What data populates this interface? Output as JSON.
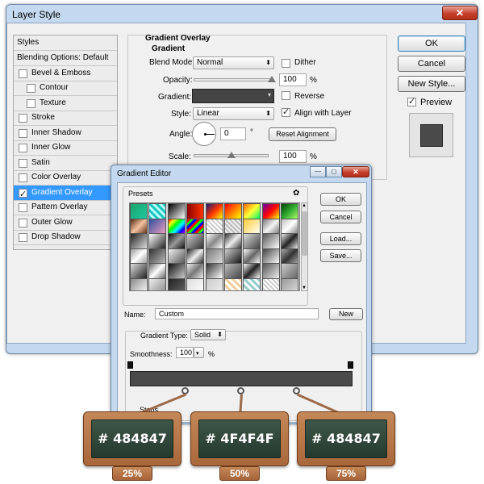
{
  "layer_style": {
    "title": "Layer Style",
    "close_glyph": "✕",
    "styles_header": "Styles",
    "items": [
      {
        "label": "Blending Options: Default",
        "checkbox": false,
        "checked": false,
        "selected": false,
        "indent": false
      },
      {
        "label": "Bevel & Emboss",
        "checkbox": true,
        "checked": false,
        "selected": false,
        "indent": false
      },
      {
        "label": "Contour",
        "checkbox": true,
        "checked": false,
        "selected": false,
        "indent": true
      },
      {
        "label": "Texture",
        "checkbox": true,
        "checked": false,
        "selected": false,
        "indent": true
      },
      {
        "label": "Stroke",
        "checkbox": true,
        "checked": false,
        "selected": false,
        "indent": false
      },
      {
        "label": "Inner Shadow",
        "checkbox": true,
        "checked": false,
        "selected": false,
        "indent": false
      },
      {
        "label": "Inner Glow",
        "checkbox": true,
        "checked": false,
        "selected": false,
        "indent": false
      },
      {
        "label": "Satin",
        "checkbox": true,
        "checked": false,
        "selected": false,
        "indent": false
      },
      {
        "label": "Color Overlay",
        "checkbox": true,
        "checked": false,
        "selected": false,
        "indent": false
      },
      {
        "label": "Gradient Overlay",
        "checkbox": true,
        "checked": true,
        "selected": true,
        "indent": false
      },
      {
        "label": "Pattern Overlay",
        "checkbox": true,
        "checked": false,
        "selected": false,
        "indent": false
      },
      {
        "label": "Outer Glow",
        "checkbox": true,
        "checked": false,
        "selected": false,
        "indent": false
      },
      {
        "label": "Drop Shadow",
        "checkbox": true,
        "checked": false,
        "selected": false,
        "indent": false
      }
    ],
    "panel": {
      "heading": "Gradient Overlay",
      "subheading": "Gradient",
      "blend_mode_label": "Blend Mode:",
      "blend_mode_value": "Normal",
      "dither_label": "Dither",
      "dither_checked": false,
      "opacity_label": "Opacity:",
      "opacity_value": "100",
      "opacity_unit": "%",
      "opacity_level": 1.0,
      "gradient_label": "Gradient:",
      "reverse_label": "Reverse",
      "reverse_checked": false,
      "style_label": "Style:",
      "style_value": "Linear",
      "align_label": "Align with Layer",
      "align_checked": true,
      "angle_label": "Angle:",
      "angle_value": "0",
      "angle_unit": "°",
      "reset_label": "Reset Alignment",
      "scale_label": "Scale:",
      "scale_value": "100",
      "scale_unit": "%",
      "scale_level": 0.5
    },
    "buttons": {
      "ok": "OK",
      "cancel": "Cancel",
      "new_style": "New Style...",
      "preview": "Preview"
    },
    "preview_checked": true,
    "preview_swatch_color": "#4a4a4a"
  },
  "gradient_editor": {
    "title": "Gradient Editor",
    "caption_glyphs": [
      "—",
      "◻",
      "✕"
    ],
    "presets_label": "Presets",
    "presets_menu_glyph": "✿",
    "buttons": {
      "ok": "OK",
      "cancel": "Cancel",
      "load": "Load...",
      "save": "Save..."
    },
    "name_label": "Name:",
    "name_value": "Custom",
    "new_label": "New",
    "gradient_type_label": "Gradient Type:",
    "gradient_type_value": "Solid",
    "smoothness_label": "Smoothness:",
    "smoothness_value": "100",
    "smoothness_unit": "%",
    "stops_label": "Stops",
    "bar_color": "#4a4a4a",
    "opacity_stops": [
      0,
      100
    ],
    "color_stops": [
      25,
      50,
      75
    ]
  },
  "annotations": [
    {
      "color": "# 484847",
      "percent": "25%"
    },
    {
      "color": "# 4F4F4F",
      "percent": "50%"
    },
    {
      "color": "# 484847",
      "percent": "75%"
    }
  ],
  "preset_swatches": [
    [
      "linear-gradient(135deg,#1aa36b,#1ec9a0)",
      "repeating-linear-gradient(45deg,#1dc7c0 0 3px,#bff 3px 6px)",
      "linear-gradient(135deg,#000,#fff)",
      "linear-gradient(90deg,#8b0000,#ff3300)",
      "linear-gradient(135deg,#1a1a7a,#ff3300,#ffff00)",
      "linear-gradient(135deg,#ff0000,#ffff00)",
      "linear-gradient(135deg,#ff6600,#ffff33,#00ff66)",
      "linear-gradient(135deg,#6600aa,#ff0000,#ffff00)",
      "linear-gradient(135deg,#004400,#33aa33,#aaff66)"
    ],
    [
      "linear-gradient(135deg,#5a2a10,#f2c2a0,#5a2a10)",
      "linear-gradient(135deg,#3050a0,#f0a0c0)",
      "linear-gradient(135deg,#ff0000,#ffff00,#00ff00,#00ffff,#0000ff,#ff00ff)",
      "repeating-linear-gradient(135deg,#ff0000 0 3px,#00ff00 3px 6px,#0000ff 6px 9px)",
      "repeating-linear-gradient(45deg,#ccc 0 2px,#fff 2px 4px)",
      "repeating-linear-gradient(45deg,#bbb 0 2px,#eee 2px 4px)",
      "linear-gradient(135deg,#ffcc33,#ffffff)",
      "linear-gradient(135deg,#777,#f4f4f4,#777)",
      "linear-gradient(135deg,#c0c0c0,#fff,#808080)"
    ],
    [
      "linear-gradient(135deg,#222,#ddd)",
      "linear-gradient(135deg,#fff,#222)",
      "linear-gradient(135deg,#111,#999,#111)",
      "linear-gradient(135deg,#ccc,#333)",
      "linear-gradient(135deg,#fff,#888,#fff)",
      "linear-gradient(135deg,#333,#eee,#333)",
      "linear-gradient(135deg,#ddd,#444)",
      "linear-gradient(135deg,#555,#fff)",
      "linear-gradient(135deg,#eee,#222,#eee)"
    ],
    [
      "linear-gradient(135deg,#999,#fff,#999)",
      "linear-gradient(135deg,#333,#bbb)",
      "linear-gradient(135deg,#eee,#555)",
      "linear-gradient(135deg,#222,#eee,#222)",
      "linear-gradient(135deg,#777,#ddd)",
      "linear-gradient(135deg,#ccc,#111)",
      "linear-gradient(135deg,#fff,#666,#fff)",
      "linear-gradient(135deg,#444,#fff)",
      "linear-gradient(135deg,#aaa,#333,#aaa)"
    ],
    [
      "linear-gradient(135deg,#ddd,#222)",
      "linear-gradient(135deg,#666,#fff,#666)",
      "linear-gradient(135deg,#111,#ccc)",
      "linear-gradient(135deg,#eee,#777,#eee)",
      "linear-gradient(135deg,#333,#fff)",
      "linear-gradient(135deg,#bbb,#444)",
      "linear-gradient(135deg,#fff,#222,#fff)",
      "linear-gradient(135deg,#555,#eee)",
      "linear-gradient(135deg,#ccc,#666)"
    ],
    [
      "linear-gradient(135deg,#888,#fff)",
      "linear-gradient(135deg,#eee,#888)",
      "linear-gradient(135deg,#222,#666)",
      "linear-gradient(135deg,#ddd,#fff)",
      "linear-gradient(135deg,#ccc,#eee)",
      "repeating-linear-gradient(45deg,#f0d0a0 0 3px,#fff 3px 6px)",
      "repeating-linear-gradient(45deg,#9cc 0 3px,#fff 3px 6px)",
      "repeating-linear-gradient(45deg,#ccc 0 2px,#fff 2px 4px)",
      "linear-gradient(135deg,#999,#ddd)"
    ]
  ]
}
